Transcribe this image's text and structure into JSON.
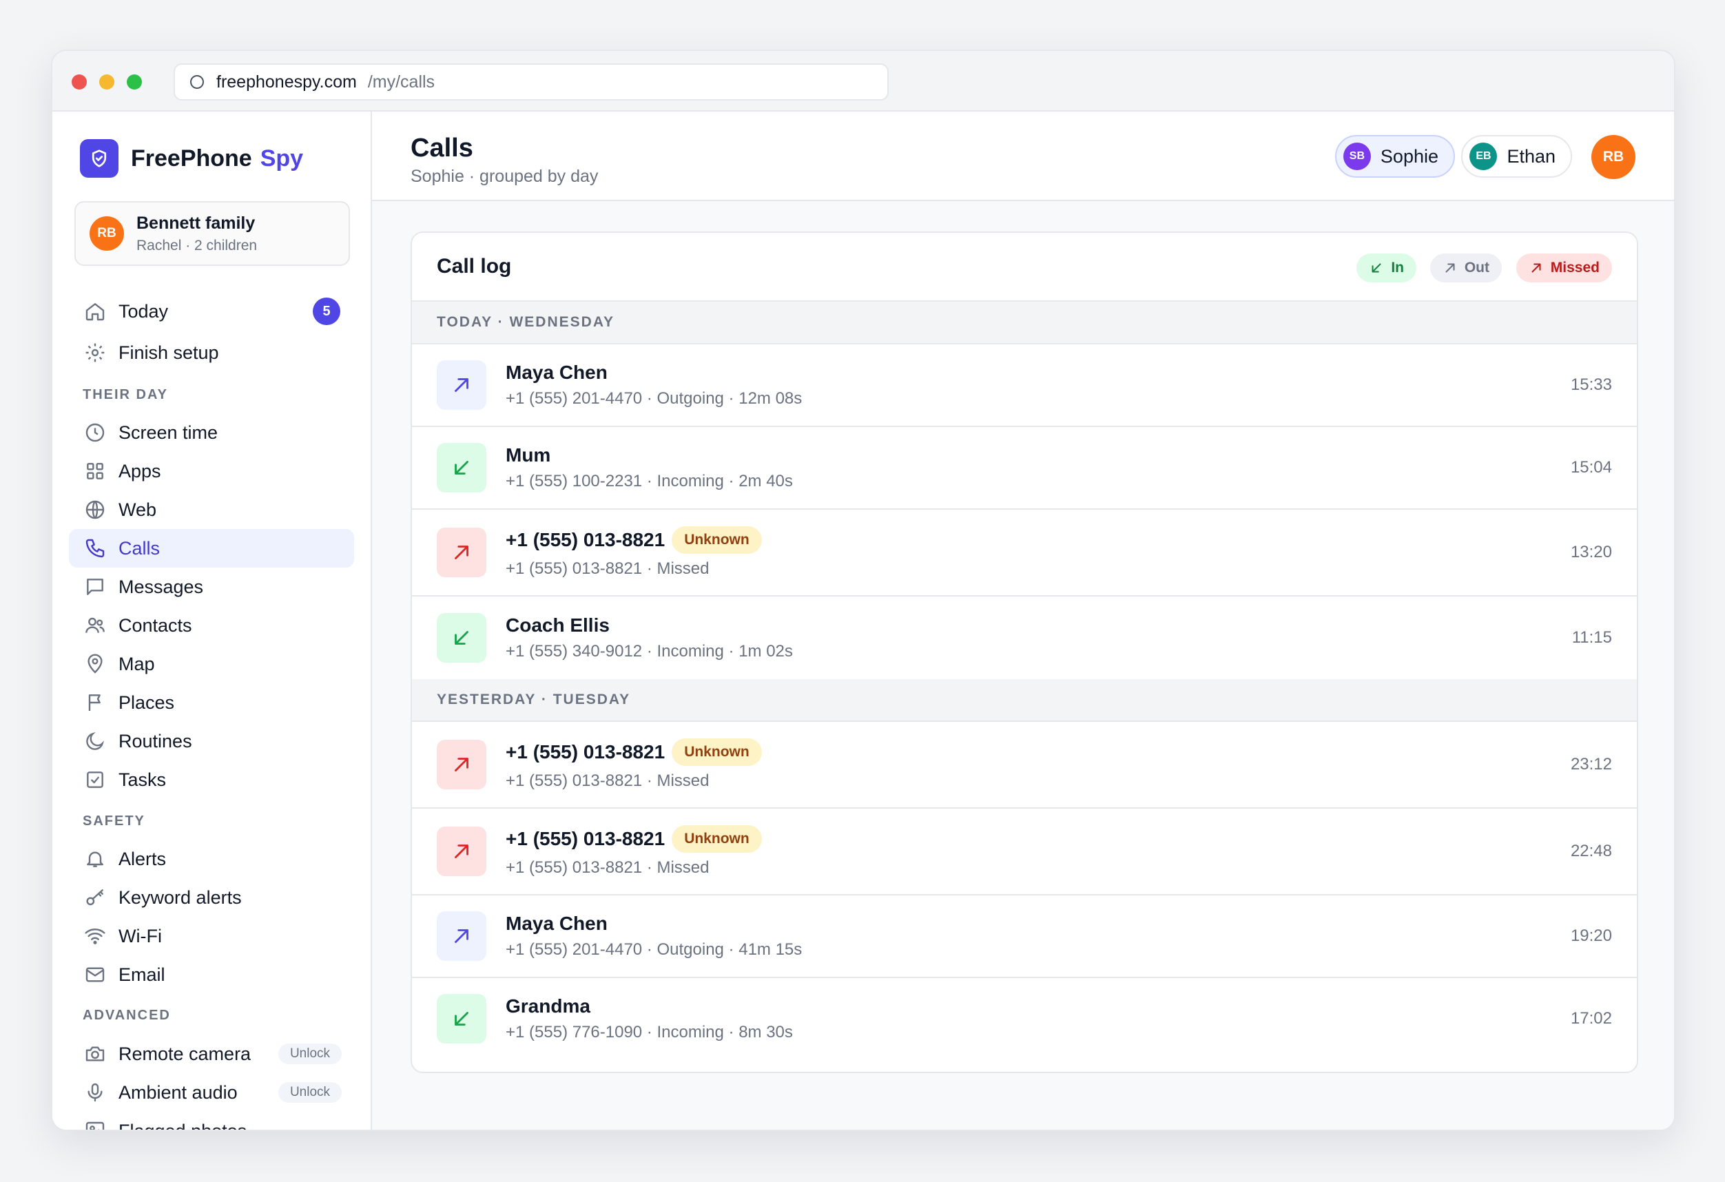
{
  "browser": {
    "domain": "freephonespy.com",
    "path": "/my/calls"
  },
  "brand": {
    "name": "FreePhone",
    "accent": "Spy",
    "color": "#4f46e5"
  },
  "family": {
    "initials": "RB",
    "title": "Bennett family",
    "subtitle": "Rachel · 2 children"
  },
  "nav": {
    "today": {
      "label": "Today",
      "badge": "5"
    },
    "finish_setup": {
      "label": "Finish setup"
    },
    "their_day_label": "THEIR DAY",
    "screen_time": "Screen time",
    "apps": "Apps",
    "web": "Web",
    "calls": "Calls",
    "messages": "Messages",
    "contacts": "Contacts",
    "map": "Map",
    "places": "Places",
    "routines": "Routines",
    "tasks": "Tasks",
    "safety_label": "SAFETY",
    "alerts": "Alerts",
    "keyword_alerts": "Keyword alerts",
    "wifi": "Wi-Fi",
    "email": "Email",
    "advanced_label": "ADVANCED",
    "remote_camera": "Remote camera",
    "ambient_audio": "Ambient audio",
    "flagged_photos": "Flagged photos",
    "unlock": "Unlock"
  },
  "header": {
    "title": "Calls",
    "subtitle": "Sophie · grouped by day",
    "children": [
      {
        "initials": "SB",
        "name": "Sophie",
        "active": true
      },
      {
        "initials": "EB",
        "name": "Ethan",
        "active": false
      }
    ],
    "user_initials": "RB"
  },
  "call_log": {
    "title": "Call log",
    "legend": {
      "in": "In",
      "out": "Out",
      "missed": "Missed"
    },
    "unknown_label": "Unknown",
    "days": [
      {
        "label": "TODAY · WEDNESDAY",
        "calls": [
          {
            "type": "outgoing",
            "name": "Maya Chen",
            "detail": "+1 (555) 201-4470 · Outgoing · 12m 08s",
            "time": "15:33"
          },
          {
            "type": "incoming",
            "name": "Mum",
            "detail": "+1 (555) 100-2231 · Incoming · 2m 40s",
            "time": "15:04"
          },
          {
            "type": "missed",
            "name": "+1 (555) 013-8821",
            "detail": "+1 (555) 013-8821 · Missed",
            "time": "13:20"
          },
          {
            "type": "incoming",
            "name": "Coach Ellis",
            "detail": "+1 (555) 340-9012 · Incoming · 1m 02s",
            "time": "11:15"
          }
        ]
      },
      {
        "label": "YESTERDAY · TUESDAY",
        "calls": [
          {
            "type": "missed",
            "name": "+1 (555) 013-8821",
            "detail": "+1 (555) 013-8821 · Missed",
            "time": "23:12"
          },
          {
            "type": "missed",
            "name": "+1 (555) 013-8821",
            "detail": "+1 (555) 013-8821 · Missed",
            "time": "22:48"
          },
          {
            "type": "outgoing",
            "name": "Maya Chen",
            "detail": "+1 (555) 201-4470 · Outgoing · 41m 15s",
            "time": "19:20"
          },
          {
            "type": "incoming",
            "name": "Grandma",
            "detail": "+1 (555) 776-1090 · Incoming · 8m 30s",
            "time": "17:02"
          }
        ]
      }
    ]
  },
  "colors": {
    "incoming": "#16a34a",
    "outgoing": "#4f46e5",
    "missed": "#dc2626",
    "accent": "#4f46e5",
    "avatar_orange": "#f97316"
  }
}
